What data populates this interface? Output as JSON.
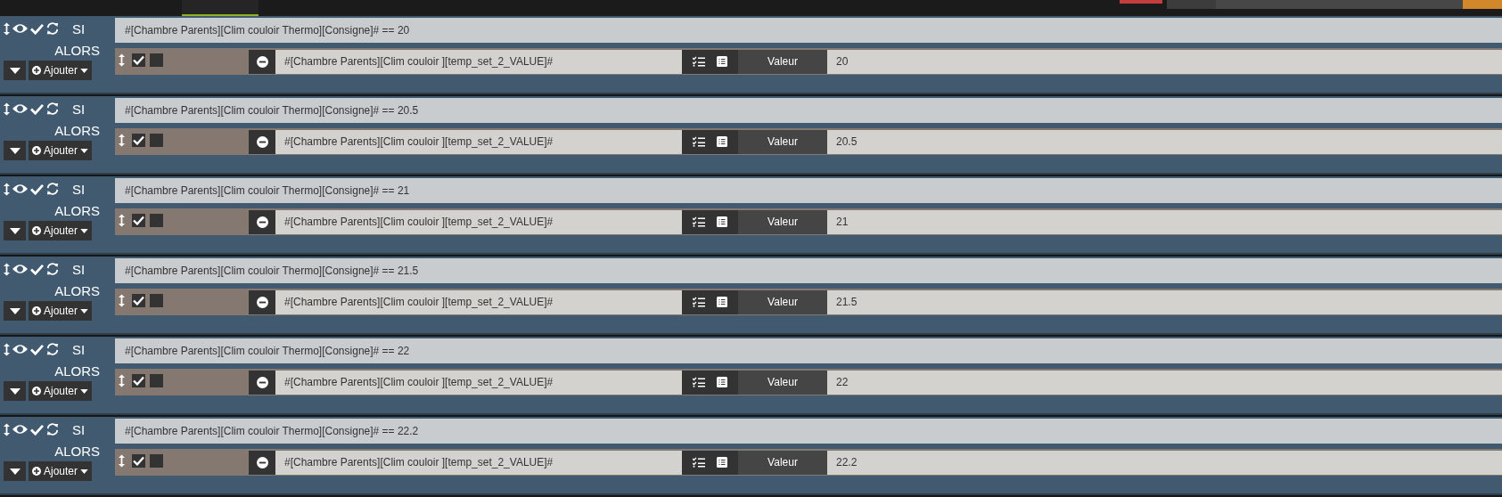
{
  "blocks": [
    {
      "if_label": "SI",
      "then_label": "ALORS",
      "add_label": "Ajouter",
      "condition": "#[Chambre Parents][Clim couloir Thermo][Consigne]# == 20",
      "action": {
        "command": "#[Chambre Parents][Clim couloir ][temp_set_2_VALUE]#",
        "param_label": "Valeur",
        "value": "20",
        "options": [
          {
            "checked": true
          },
          {
            "checked": false
          }
        ]
      }
    },
    {
      "if_label": "SI",
      "then_label": "ALORS",
      "add_label": "Ajouter",
      "condition": "#[Chambre Parents][Clim couloir Thermo][Consigne]# == 20.5",
      "action": {
        "command": "#[Chambre Parents][Clim couloir ][temp_set_2_VALUE]#",
        "param_label": "Valeur",
        "value": "20.5",
        "options": [
          {
            "checked": true
          },
          {
            "checked": false
          }
        ]
      }
    },
    {
      "if_label": "SI",
      "then_label": "ALORS",
      "add_label": "Ajouter",
      "condition": "#[Chambre Parents][Clim couloir Thermo][Consigne]# == 21",
      "action": {
        "command": "#[Chambre Parents][Clim couloir ][temp_set_2_VALUE]#",
        "param_label": "Valeur",
        "value": "21",
        "options": [
          {
            "checked": true
          },
          {
            "checked": false
          }
        ]
      }
    },
    {
      "if_label": "SI",
      "then_label": "ALORS",
      "add_label": "Ajouter",
      "condition": "#[Chambre Parents][Clim couloir Thermo][Consigne]# == 21.5",
      "action": {
        "command": "#[Chambre Parents][Clim couloir ][temp_set_2_VALUE]#",
        "param_label": "Valeur",
        "value": "21.5",
        "options": [
          {
            "checked": true
          },
          {
            "checked": false
          }
        ]
      }
    },
    {
      "if_label": "SI",
      "then_label": "ALORS",
      "add_label": "Ajouter",
      "condition": "#[Chambre Parents][Clim couloir Thermo][Consigne]# == 22",
      "action": {
        "command": "#[Chambre Parents][Clim couloir ][temp_set_2_VALUE]#",
        "param_label": "Valeur",
        "value": "22",
        "options": [
          {
            "checked": true
          },
          {
            "checked": false
          }
        ]
      }
    },
    {
      "if_label": "SI",
      "then_label": "ALORS",
      "add_label": "Ajouter",
      "condition": "#[Chambre Parents][Clim couloir Thermo][Consigne]# == 22.2",
      "action": {
        "command": "#[Chambre Parents][Clim couloir ][temp_set_2_VALUE]#",
        "param_label": "Valeur",
        "value": "22.2",
        "options": [
          {
            "checked": true
          },
          {
            "checked": false
          }
        ]
      }
    }
  ]
}
